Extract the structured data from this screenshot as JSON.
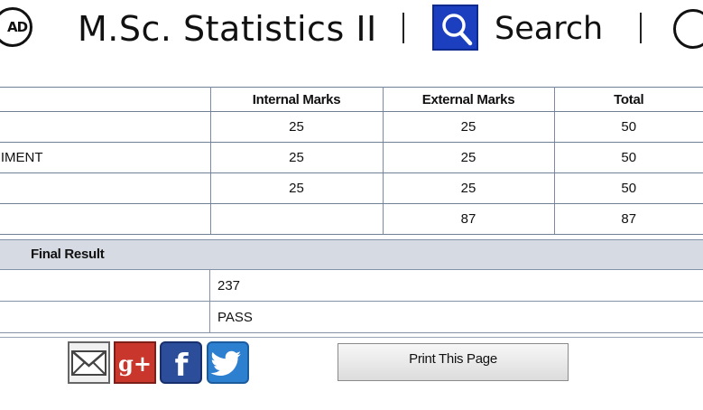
{
  "header": {
    "logo_text": "AD",
    "title": "M.Sc. Statistics II",
    "search_label": "Search"
  },
  "table": {
    "headers": [
      "",
      "Internal Marks",
      "External Marks",
      "Total"
    ],
    "rows": [
      {
        "subject": "",
        "internal": "25",
        "external": "25",
        "total": "50"
      },
      {
        "subject": "ERIMENT",
        "internal": "25",
        "external": "25",
        "total": "50"
      },
      {
        "subject": "",
        "internal": "25",
        "external": "25",
        "total": "50"
      },
      {
        "subject": "",
        "internal": "",
        "external": "87",
        "total": "87"
      }
    ]
  },
  "final_result": {
    "title": "Final Result",
    "total": "237",
    "status": "PASS"
  },
  "share": {
    "icons": [
      "mail-icon",
      "google-plus-icon",
      "facebook-icon",
      "twitter-icon"
    ],
    "gplus_text": "g+",
    "fb_text": "f"
  },
  "print_button": {
    "label": "Print This Page"
  },
  "colors": {
    "search_blue": "#1c3fbf",
    "final_bar": "#d6dbe3",
    "gplus_red": "#c9372c",
    "facebook_blue": "#2b4d9a",
    "twitter_blue": "#2d7fd0"
  }
}
